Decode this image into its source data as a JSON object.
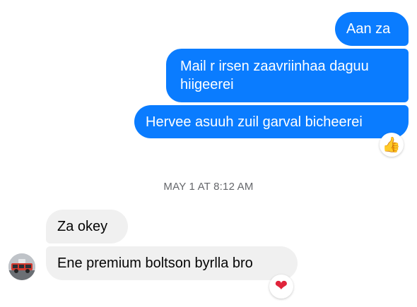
{
  "conversation": {
    "messages": [
      {
        "direction": "outgoing",
        "text": "Aan za"
      },
      {
        "direction": "outgoing",
        "text": "Mail r irsen zaavriinhaa daguu hiigeerei"
      },
      {
        "direction": "outgoing",
        "text": "Hervee asuuh zuil garval bicheerei",
        "reaction": "thumbs-up-icon"
      },
      {
        "direction": "incoming",
        "text": "Za okey"
      },
      {
        "direction": "incoming",
        "text": "Ene premium boltson byrlla bro",
        "reaction": "heart-icon"
      }
    ],
    "timestamp": "MAY 1 AT 8:12 AM",
    "colors": {
      "outgoing_bubble": "#0a7cff",
      "incoming_bubble": "#f0f0f0",
      "timestamp_text": "#65676b"
    }
  }
}
